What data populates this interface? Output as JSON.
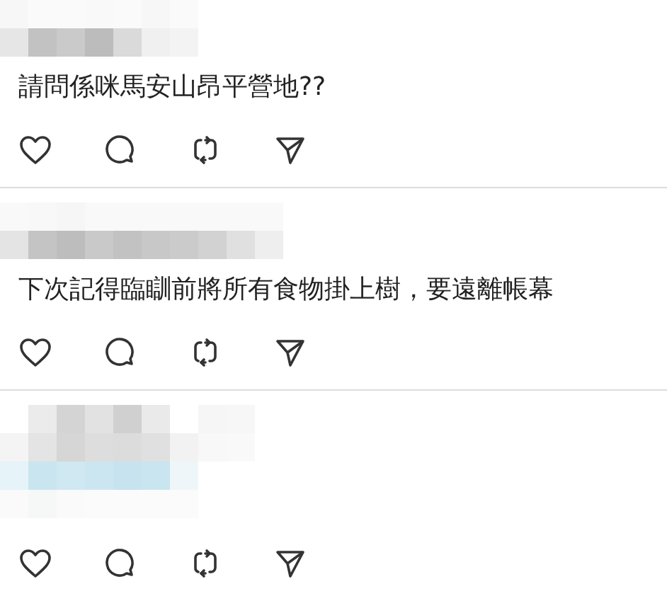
{
  "comments": [
    {
      "kind": "text",
      "text": "請問係咪馬安山昂平營地??"
    },
    {
      "kind": "text",
      "text": "下次記得臨瞓前將所有食物掛上樹，要遠離帳幕"
    },
    {
      "kind": "blurred"
    }
  ]
}
